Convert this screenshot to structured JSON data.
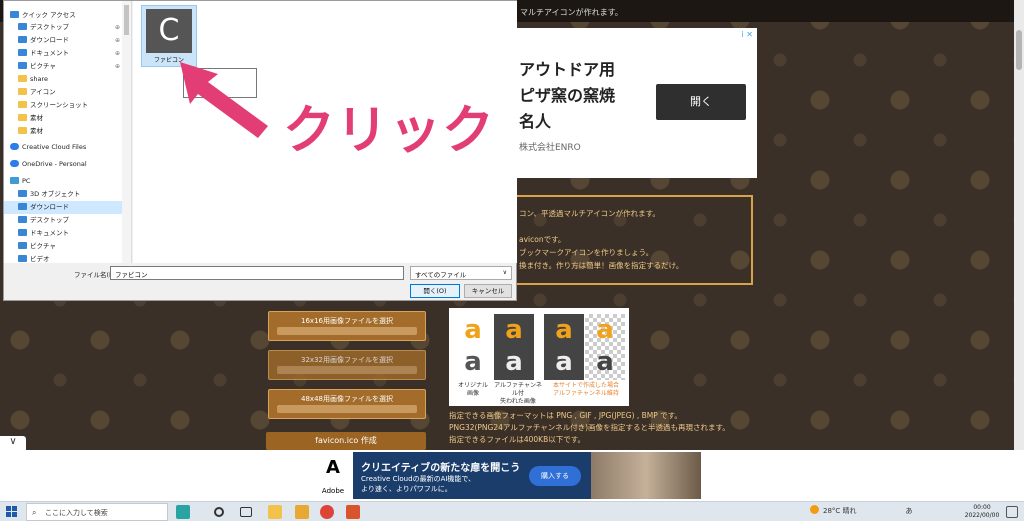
{
  "page": {
    "header_text": "マルチアイコンが作れます。",
    "scroll_up": "^"
  },
  "ad_top": {
    "lines": [
      "アウトドア用",
      "ピザ窯の窯焼",
      "名人"
    ],
    "company": "株式会社ENRO",
    "open_button": "開く",
    "ad_mark": "i ✕"
  },
  "description": {
    "lines": [
      "コン、平透過マルチアイコンが作れます。",
      "",
      "aviconです。",
      "ブックマークアイコンを作りましょう。",
      "換ま付き。作り方は簡単！画像を指定するだけ。"
    ]
  },
  "select_buttons": [
    {
      "label": "16x16用画像ファイルを選択"
    },
    {
      "label": "32x32用画像ファイルを選択"
    },
    {
      "label": "48x48用画像ファイルを選択"
    }
  ],
  "create_button": "favicon.ico 作成",
  "sample": {
    "glyph": "a",
    "captions": [
      "オリジナル\n画像",
      "アルファチャンネル付\n失われた画像",
      "本サイトで作成した場合\nアルファチャンネル維持"
    ]
  },
  "format_info": [
    "指定できる画像フォーマットは PNG , GIF , JPG(JPEG) , BMP です。",
    "PNG32(PNG24アルファチャンネル付き)画像を指定すると半透過も再現されます。",
    "指定できるファイルは400KB以下です。"
  ],
  "bottom_ad": {
    "brand": "Adobe",
    "title": "クリエイティブの新たな扉を開こう",
    "subtitle_line1": "Creative Cloudの最新のAI機能で、",
    "subtitle_line2": "より速く、よりパワフルに。",
    "buy_button": "購入する"
  },
  "dialog": {
    "nav_items": [
      {
        "label": "クイック アクセス",
        "icon": "star-icon",
        "pinned": false
      },
      {
        "label": "デスクトップ",
        "icon": "desktop-icon",
        "pinned": true
      },
      {
        "label": "ダウンロード",
        "icon": "download-icon",
        "pinned": true
      },
      {
        "label": "ドキュメント",
        "icon": "document-icon",
        "pinned": true
      },
      {
        "label": "ピクチャ",
        "icon": "pictures-icon",
        "pinned": true
      },
      {
        "label": "share",
        "icon": "folder-icon",
        "pinned": false
      },
      {
        "label": "アイコン",
        "icon": "folder-icon",
        "pinned": false
      },
      {
        "label": "スクリーンショット",
        "icon": "folder-icon",
        "pinned": false
      },
      {
        "label": "素材",
        "icon": "folder-icon",
        "pinned": false
      },
      {
        "label": "素材",
        "icon": "folder-icon",
        "pinned": false
      },
      {
        "label": "Creative Cloud Files",
        "icon": "cloud-icon",
        "pinned": false
      },
      {
        "label": "OneDrive - Personal",
        "icon": "cloud-icon",
        "pinned": false
      },
      {
        "label": "PC",
        "icon": "pc-icon",
        "pinned": false
      },
      {
        "label": "3D オブジェクト",
        "icon": "3d-icon",
        "pinned": false
      },
      {
        "label": "ダウンロード",
        "icon": "download-icon",
        "pinned": false,
        "selected": true
      },
      {
        "label": "デスクトップ",
        "icon": "desktop-icon",
        "pinned": false
      },
      {
        "label": "ドキュメント",
        "icon": "document-icon",
        "pinned": false
      },
      {
        "label": "ピクチャ",
        "icon": "pictures-icon",
        "pinned": false
      },
      {
        "label": "ビデオ",
        "icon": "video-icon",
        "pinned": false
      }
    ],
    "pin_glyph": "⊕",
    "file": {
      "name": "ファビコン",
      "thumb_glyph": "C"
    },
    "tooltip": [
      "種",
      "大",
      "サイ"
    ],
    "filename_label": "ファイル名(N):",
    "filename_value": "ファビコン",
    "filetype_value": "すべてのファイル",
    "filetype_chevron": "∨",
    "open_button": "開く(O)",
    "cancel_button": "キャンセル",
    "expand_chevron": "∨"
  },
  "annotation": {
    "label": "クリック",
    "color": "#e33d76"
  },
  "taskbar": {
    "search_placeholder": "ここに入力して検索",
    "search_icon": "⌕",
    "weather": "28°C 晴れ",
    "ime": "あ",
    "time": "00:00",
    "date": "2022/00/00"
  }
}
